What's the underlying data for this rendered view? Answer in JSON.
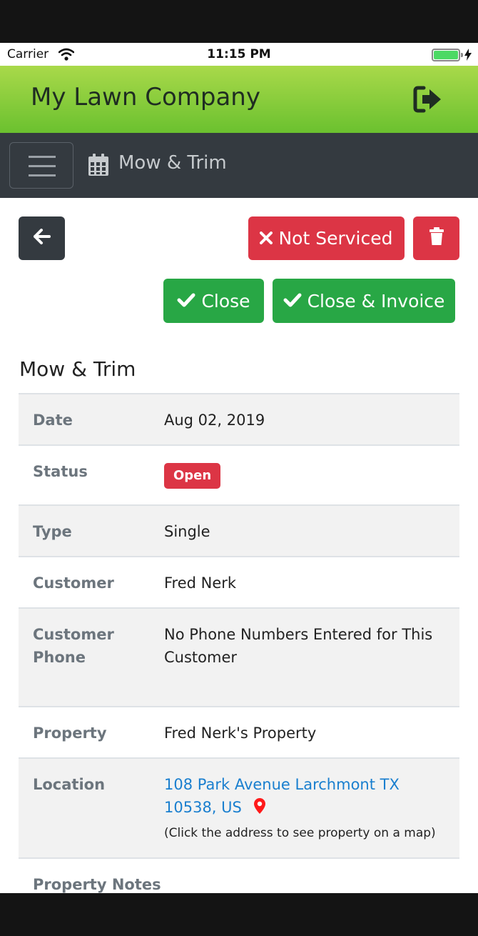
{
  "status_bar": {
    "carrier": "Carrier",
    "time": "11:15 PM"
  },
  "header": {
    "brand": "My Lawn Company",
    "logout_icon": "sign-out-icon",
    "accent": "#7cc63a"
  },
  "navbar": {
    "menu_icon": "hamburger-icon",
    "page_icon": "calendar-icon",
    "title": "Mow & Trim"
  },
  "actions": {
    "back_icon": "arrow-left-icon",
    "not_serviced_label": "Not Serviced",
    "trash_icon": "trash-icon",
    "close_label": "Close",
    "close_invoice_label": "Close & Invoice",
    "danger_color": "#dc3545",
    "success_color": "#28a745"
  },
  "section_title": "Mow & Trim",
  "details": {
    "date_label": "Date",
    "date_value": "Aug 02, 2019",
    "status_label": "Status",
    "status_value": "Open",
    "type_label": "Type",
    "type_value": "Single",
    "customer_label": "Customer",
    "customer_value": "Fred Nerk",
    "phone_label_line1": "Customer",
    "phone_label_line2": "Phone",
    "phone_value_line1": "No Phone Numbers Entered for This",
    "phone_value_line2": "Customer",
    "property_label": "Property",
    "property_value": "Fred Nerk's Property",
    "location_label": "Location",
    "location_line1": "108 Park Avenue Larchmont TX",
    "location_line2": "10538, US",
    "location_icon": "map-marker-icon",
    "location_hint": "(Click the address to see property on a map)",
    "notes_label": "Property Notes"
  }
}
